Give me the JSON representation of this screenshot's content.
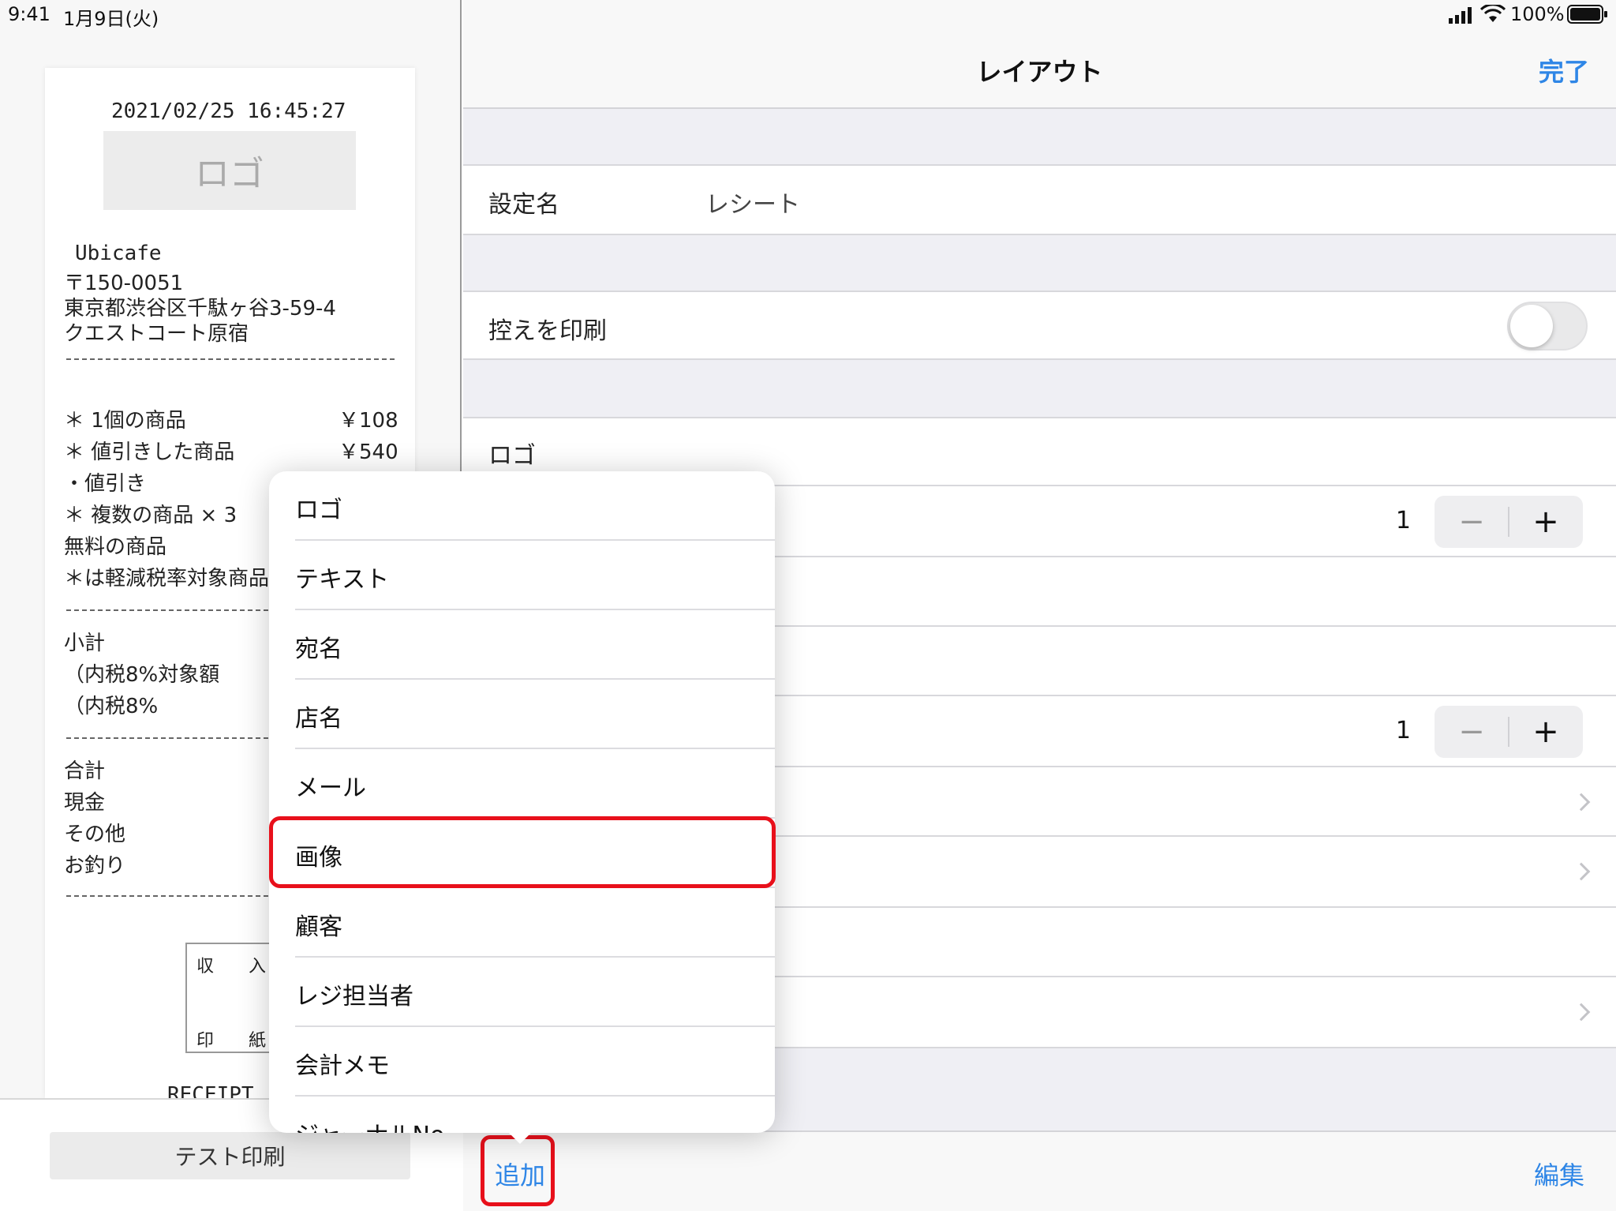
{
  "status_bar": {
    "time": "9:41",
    "date": "1月9日(火)",
    "battery": "100%"
  },
  "receipt": {
    "datetime": "2021/02/25 16:45:27",
    "logo_placeholder": "ロゴ",
    "store_name": "Ubicafe",
    "postal": "〒150-0051",
    "address1": "東京都渋谷区千駄ヶ谷3-59-4",
    "address2": "クエストコート原宿",
    "items": [
      {
        "name": "＊ 1個の商品",
        "price": "￥108"
      },
      {
        "name": "＊ 値引きした商品",
        "price": "￥540"
      },
      {
        "name": "・値引き",
        "price": ""
      },
      {
        "name": "＊ 複数の商品 × 3",
        "price": ""
      },
      {
        "name": "無料の商品",
        "price": ""
      },
      {
        "name": "＊は軽減税率対象商品で",
        "price": ""
      }
    ],
    "subtotal": "小計",
    "tax_target": "（内税8%対象額",
    "tax": "（内税8%",
    "total": "合計",
    "cash": "現金",
    "other": "その他",
    "change": "お釣り",
    "stamp_chars": [
      "収",
      "入",
      "印",
      "紙"
    ],
    "footer": "RECEIPT"
  },
  "left_toolbar": {
    "test_print_label": "テスト印刷"
  },
  "nav": {
    "title": "レイアウト",
    "done_label": "完了"
  },
  "settings": {
    "name_label": "設定名",
    "name_value": "レシート",
    "print_copy_label": "控えを印刷",
    "print_copy_on": false,
    "logo_label": "ロゴ",
    "stepper1_value": "1",
    "stepper2_value": "1",
    "minus": "−",
    "plus": "+"
  },
  "toolbar": {
    "add_label": "追加",
    "edit_label": "編集"
  },
  "popover": {
    "items": [
      "ロゴ",
      "テキスト",
      "宛名",
      "店名",
      "メール",
      "画像",
      "顧客",
      "レジ担当者",
      "会計メモ",
      "ジャーナルNo"
    ],
    "highlighted": "画像"
  },
  "colors": {
    "accent": "#2f86e6",
    "highlight": "#e8101b"
  }
}
